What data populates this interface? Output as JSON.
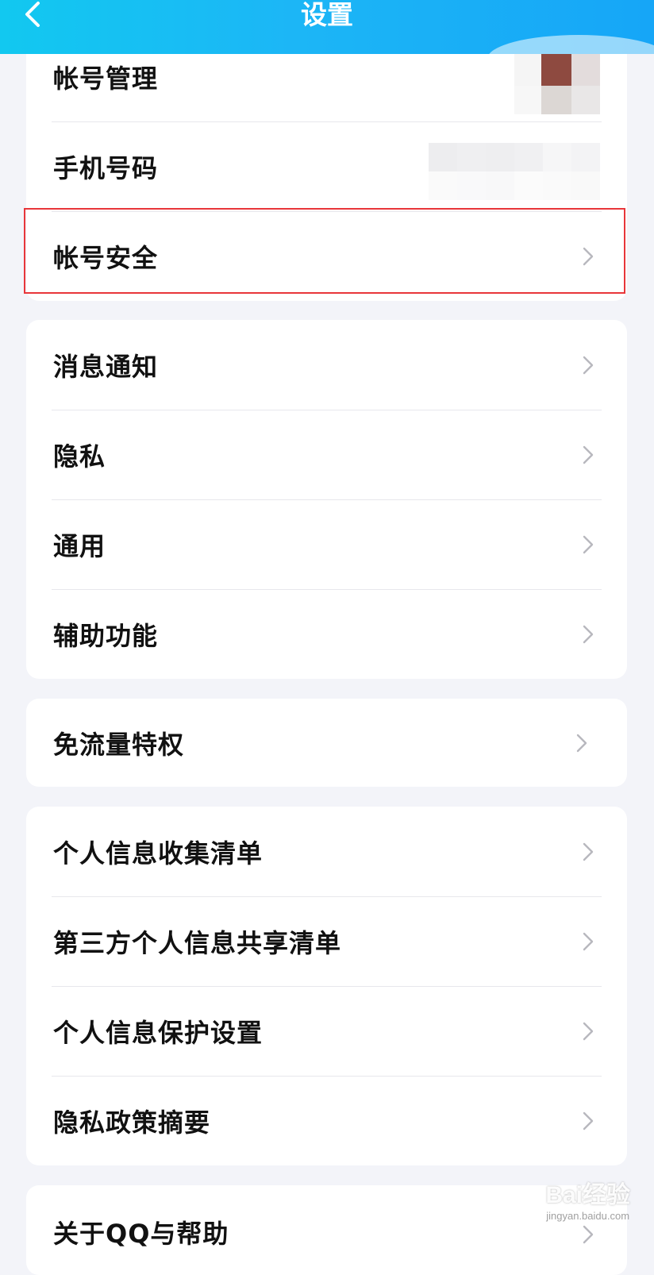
{
  "header": {
    "title": "设置",
    "colors": {
      "start": "#12c8f0",
      "end": "#16a6f7"
    }
  },
  "groups": [
    {
      "items": [
        {
          "label": "帐号管理",
          "icon": "none"
        },
        {
          "label": "手机号码",
          "icon": "none"
        },
        {
          "label": "帐号安全",
          "icon": "chevron-right-icon",
          "highlighted": true
        }
      ]
    },
    {
      "items": [
        {
          "label": "消息通知",
          "icon": "chevron-right-icon"
        },
        {
          "label": "隐私",
          "icon": "chevron-right-icon"
        },
        {
          "label": "通用",
          "icon": "chevron-right-icon"
        },
        {
          "label": "辅助功能",
          "icon": "chevron-right-icon"
        }
      ]
    },
    {
      "items": [
        {
          "label": "免流量特权",
          "icon": "chevron-right-icon"
        }
      ]
    },
    {
      "items": [
        {
          "label": "个人信息收集清单",
          "icon": "chevron-right-icon"
        },
        {
          "label": "第三方个人信息共享清单",
          "icon": "chevron-right-icon"
        },
        {
          "label": "个人信息保护设置",
          "icon": "chevron-right-icon"
        },
        {
          "label": "隐私政策摘要",
          "icon": "chevron-right-icon"
        }
      ]
    },
    {
      "items": [
        {
          "label": "关于QQ与帮助",
          "icon": "chevron-right-icon"
        }
      ]
    }
  ],
  "highlight_color": "#e8363a",
  "watermark": {
    "main": "Bai经验",
    "sub": "jingyan.baidu.com"
  }
}
